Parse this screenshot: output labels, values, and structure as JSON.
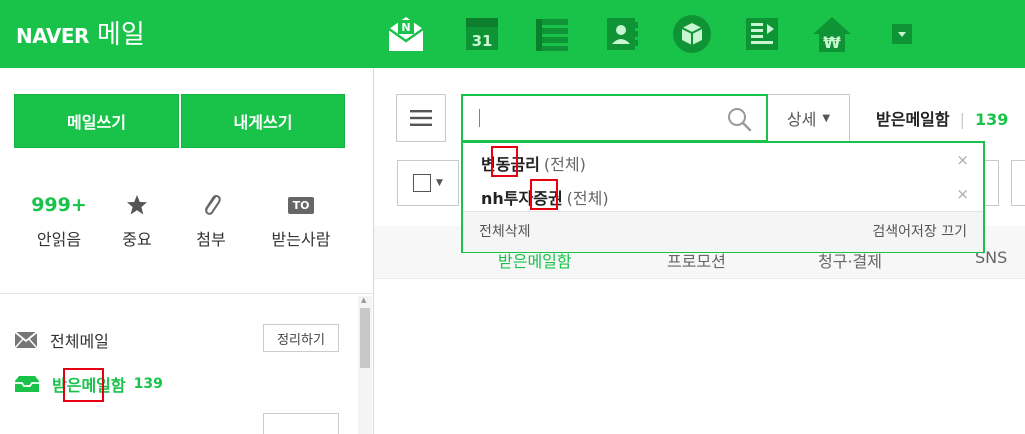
{
  "header": {
    "brand": "NAVER",
    "service": "메일",
    "apps": [
      {
        "name": "mail-app",
        "icon": "envelope-n-icon",
        "badge": "N"
      },
      {
        "name": "calendar-app",
        "icon": "calendar-icon",
        "badge": "31"
      },
      {
        "name": "todo-app",
        "icon": "list-icon"
      },
      {
        "name": "contacts-app",
        "icon": "contacts-icon"
      },
      {
        "name": "drive-app",
        "icon": "box-icon"
      },
      {
        "name": "memo-app",
        "icon": "memo-icon"
      },
      {
        "name": "household-app",
        "icon": "won-house-icon",
        "badge": "₩"
      },
      {
        "name": "more-app",
        "icon": "more-dropdown-icon"
      }
    ]
  },
  "compose": {
    "write_mail": "메일쓰기",
    "write_self": "내게쓰기"
  },
  "quick": [
    {
      "name": "unread",
      "value": "999+",
      "label": "안읽음"
    },
    {
      "name": "important",
      "icon": "star-icon",
      "label": "중요"
    },
    {
      "name": "attachment",
      "icon": "paperclip-icon",
      "label": "첨부"
    },
    {
      "name": "to-me",
      "badge": "TO",
      "label": "받는사람"
    }
  ],
  "folders": {
    "all_mail": "전체메일",
    "organize": "정리하기",
    "inbox": "받은메일함",
    "inbox_count": "139"
  },
  "toolbar": {
    "search_value": "",
    "detail": "상세",
    "mailbox": "받은메일함",
    "mailbox_count": "139"
  },
  "autocomplete": {
    "items": [
      {
        "keyword": "변동금리",
        "scope": "(전체)"
      },
      {
        "keyword": "nh투자증권",
        "scope": "(전체)"
      }
    ],
    "delete_all": "전체삭제",
    "disable_history": "검색어저장 끄기"
  },
  "tabs": [
    "받은메일함",
    "프로모션",
    "청구·결제",
    "SNS"
  ],
  "colors": {
    "brand": "#19c34a",
    "highlight": "#e60012"
  }
}
